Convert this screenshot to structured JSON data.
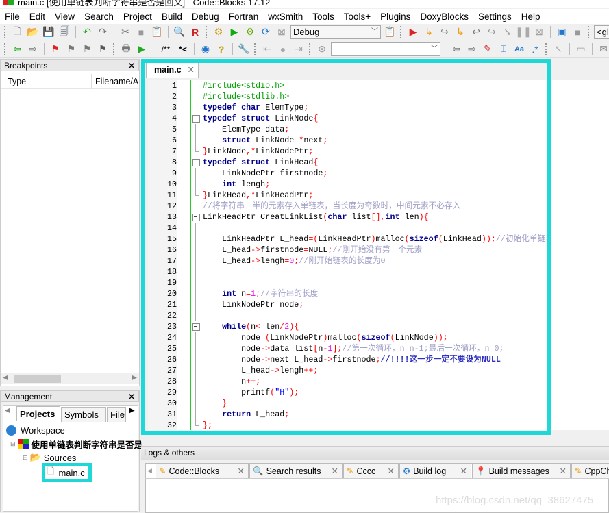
{
  "window": {
    "title": "main.c [使用单链表判断字符串是否是回文] - Code::Blocks 17.12"
  },
  "menu": [
    "File",
    "Edit",
    "View",
    "Search",
    "Project",
    "Build",
    "Debug",
    "Fortran",
    "wxSmith",
    "Tools",
    "Tools+",
    "Plugins",
    "DoxyBlocks",
    "Settings",
    "Help"
  ],
  "toolbar": {
    "build_target": "Debug",
    "scope_combo": "<glob",
    "search_combo": "",
    "comment_label": "/**",
    "comment_inline_label": "*<"
  },
  "breakpoints": {
    "title": "Breakpoints",
    "columns": [
      "Type",
      "Filename/A"
    ]
  },
  "management": {
    "title": "Management",
    "tabs": [
      "Projects",
      "Symbols",
      "Files"
    ],
    "active_tab": "Projects",
    "tree": {
      "workspace": "Workspace",
      "project": "使用单链表判断字符串是否是",
      "folder": "Sources",
      "file": "main.c"
    }
  },
  "editor": {
    "tab": "main.c",
    "lines": [
      "#include<stdio.h>",
      "#include<stdlib.h>",
      "typedef char ElemType;",
      "typedef struct LinkNode{",
      "    ElemType data;",
      "    struct LinkNode *next;",
      "}LinkNode,*LinkNodePtr;",
      "typedef struct LinkHead{",
      "    LinkNodePtr firstnode;",
      "    int lengh;",
      "}LinkHead,*LinkHeadPtr;",
      "//将字符串一半的元素存入单链表，当长度为奇数时，中间元素不必存入",
      "LinkHeadPtr CreatLinkList(char list[],int len){",
      "",
      "    LinkHeadPtr L_head=(LinkHeadPtr)malloc(sizeof(LinkHead));//初始化单链表头结点",
      "    L_head->firstnode=NULL;//刚开始没有第一个元素",
      "    L_head->lengh=0;//刚开始链表的长度为0",
      "",
      "",
      "    int n=1;//字符串的长度",
      "    LinkNodePtr node;",
      "",
      "    while(n<=len/2){",
      "        node=(LinkNodePtr)malloc(sizeof(LinkNode));",
      "        node->data=list[n-1];//第一次循环，n=n-1;最后一次循环，n=0;",
      "        node->next=L_head->firstnode;//!!!!这一步一定不要设为NULL",
      "        L_head->lengh++;",
      "        n++;",
      "        printf(\"H\");",
      "    }",
      "    return L_head;",
      "};"
    ]
  },
  "logs": {
    "title": "Logs & others",
    "tabs": [
      "Code::Blocks",
      "Search results",
      "Cccc",
      "Build log",
      "Build messages",
      "CppCh"
    ]
  },
  "watermark": "https://blog.csdn.net/qq_38627475",
  "colors": {
    "highlight": "#1ed8d8",
    "keyword": "#00008b",
    "preprocessor": "#00a000",
    "operator": "#ff0000",
    "number": "#f000f0",
    "comment": "#a0a0c8",
    "change_bar": "#22cc22"
  }
}
